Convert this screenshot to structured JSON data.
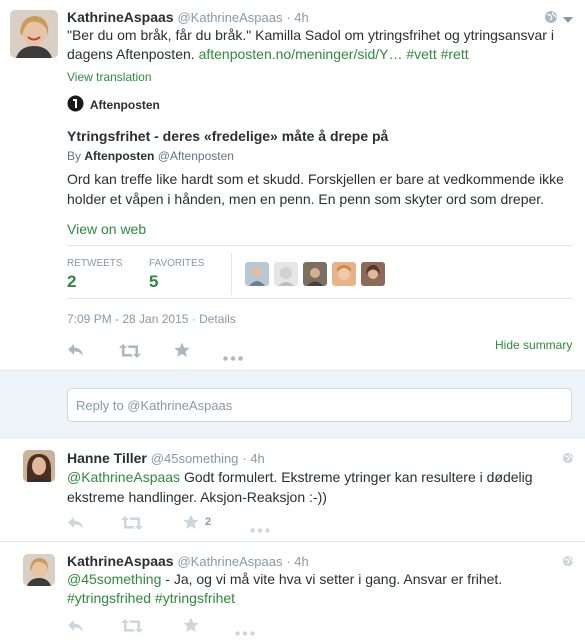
{
  "main_tweet": {
    "name": "KathrineAspaas",
    "handle": "@KathrineAspaas",
    "time": "· 4h",
    "text_plain": "\"Ber du om bråk, får du bråk.\" Kamilla Sadol om ytringsfrihet og ytringsansvar i dagens Aftenposten.",
    "link": "aftenposten.no/meninger/sid/Y…",
    "hashtag1": "#vett",
    "hashtag2": "#rett",
    "view_translation": "View translation",
    "card": {
      "source": "Aftenposten",
      "title": "Ytringsfrihet - deres «fredelige» måte å drepe på",
      "by_prefix": "By",
      "by_name": "Aftenposten",
      "by_handle": "@Aftenposten",
      "description": "Ord kan treffe like hardt som et skudd. Forskjellen er bare at vedkommende ikke holder et våpen i hånden, men en penn. En penn som skyter ord som dreper.",
      "view_on_web": "View on web"
    },
    "stats": {
      "retweets_label": "RETWEETS",
      "retweets_value": "2",
      "favorites_label": "FAVORITES",
      "favorites_value": "5"
    },
    "timestamp": "7:09 PM - 28 Jan 2015",
    "details": "· Details",
    "hide_summary": "Hide summary"
  },
  "reply_box": {
    "placeholder": "Reply to @KathrineAspaas"
  },
  "replies": [
    {
      "name": "Hanne Tiller",
      "handle": "@45something",
      "time": "· 4h",
      "mention": "@KathrineAspaas",
      "text": " Godt formulert. Ekstreme ytringer kan resultere i dødelig ekstreme handlinger. Aksjon-Reaksjon :-))",
      "favorite_count": "2"
    },
    {
      "name": "KathrineAspaas",
      "handle": "@KathrineAspaas",
      "time": "· 4h",
      "mention": "@45something",
      "text": " - Ja, og vi må vite hva vi setter i gang. Ansvar er frihet.",
      "hashtags": "#ytringsfrihed #ytringsfrihet"
    }
  ],
  "colors": {
    "link_green": "#2f8a3c",
    "icon_grey": "#aab8c2",
    "meta_grey": "#8899a6",
    "border": "#e1e8ed",
    "reply_bg": "#eef4f8"
  },
  "icons": [
    "globe-icon",
    "reply-icon",
    "retweet-icon",
    "star-icon",
    "more-icon",
    "aftenposten-logo-icon"
  ]
}
